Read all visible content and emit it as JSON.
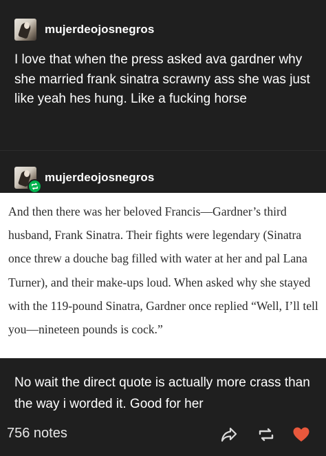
{
  "post1": {
    "username": "mujerdeojosnegros",
    "text": "I love that when the press asked ava gardner why she married frank sinatra scrawny ass she was just like yeah hes hung. Like a fucking horse"
  },
  "post2": {
    "username": "mujerdeojosnegros",
    "quote_image_text": "And then there was her beloved Francis—Gardner’s third husband, Frank Sinatra. Their fights were legendary (Sinatra once threw a douche bag filled with water at her and pal Lana Turner), and their make-ups loud. When asked why she stayed with the 119-pound Sinatra, Gardner once replied “Well, I’ll tell you—nineteen pounds is cock.”",
    "reply_text": "No wait the direct quote is actually more crass than the way i worded it. Good for her"
  },
  "footer": {
    "notes_label": "756 notes"
  },
  "icons": {
    "share": "share-icon",
    "reblog": "reblog-icon",
    "like": "heart-icon",
    "reblog_badge": "reblog-badge-icon"
  },
  "colors": {
    "background": "#1f1f1f",
    "text": "#ffffff",
    "reblog_green": "#00b44f",
    "heart_red": "#e8583c"
  }
}
